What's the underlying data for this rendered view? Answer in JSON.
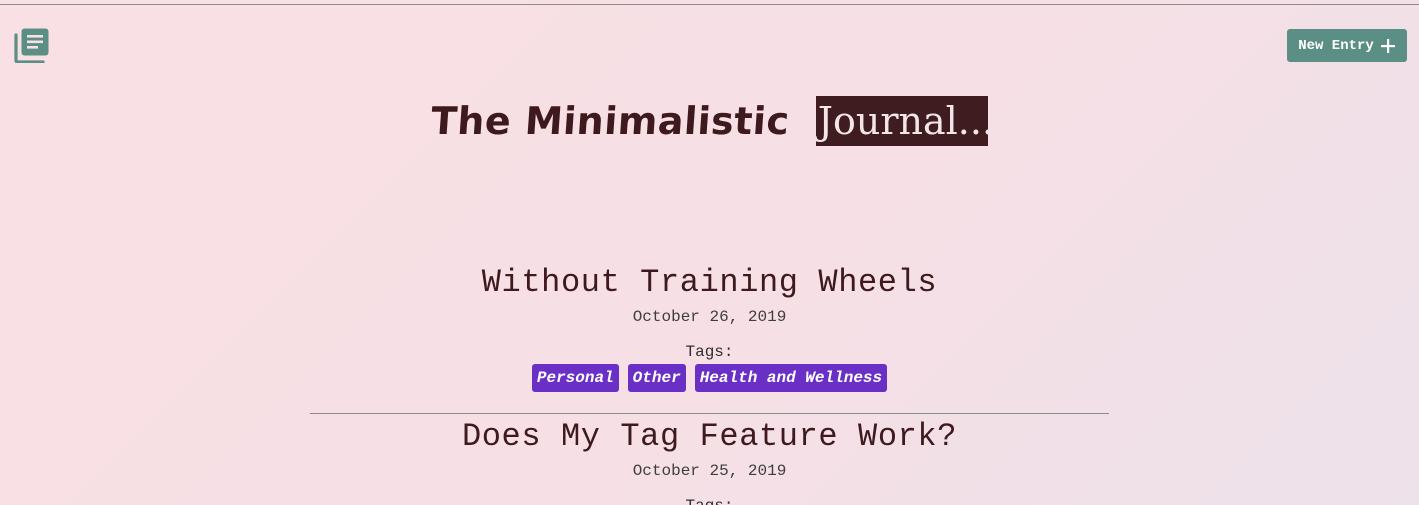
{
  "header": {
    "menu_icon": "journal-list-icon",
    "new_entry_label": "New Entry",
    "new_entry_icon": "plus-icon",
    "accent_color": "#5b8e84"
  },
  "title": {
    "part1": "The Minimalistic",
    "part2": "Journal..."
  },
  "entries": [
    {
      "title": "Without Training Wheels",
      "date": "October 26, 2019",
      "tags_label": "Tags:",
      "tags": [
        "Personal",
        "Other",
        "Health and Wellness"
      ]
    },
    {
      "title": "Does My Tag Feature Work?",
      "date": "October 25, 2019",
      "tags_label": "Tags:"
    }
  ],
  "colors": {
    "tag_bg": "#6a2fc4",
    "text": "#3e1a1f",
    "title_highlight_bg": "#3f1c1f"
  }
}
